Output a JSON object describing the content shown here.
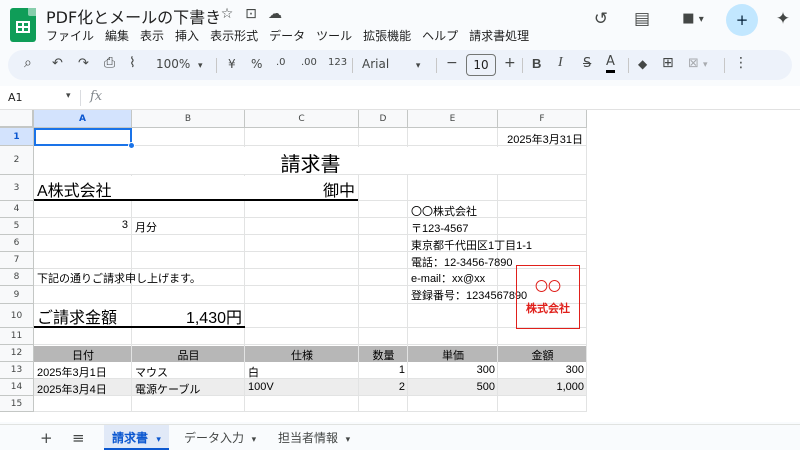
{
  "app": {
    "title": "PDF化とメールの下書き",
    "menu": [
      "ファイル",
      "編集",
      "表示",
      "挿入",
      "表示形式",
      "データ",
      "ツール",
      "拡張機能",
      "ヘルプ",
      "請求書処理"
    ]
  },
  "icons": {
    "star": "☆",
    "folder": "⊡",
    "cloud": "☁",
    "history": "↺",
    "comment": "▤",
    "video": "■",
    "share": "+",
    "gemini": "✦"
  },
  "toolbar": {
    "search": "⌕",
    "undo": "↶",
    "redo": "↷",
    "print": "⎙",
    "paint_format": "⌇",
    "zoom": "100%",
    "currency": "¥",
    "percent": "%",
    "decimal_decrease": ".0",
    "decimal_increase": ".00",
    "number_format": "123",
    "font": "Arial",
    "minus": "−",
    "font_size": "10",
    "plus": "+",
    "bold": "B",
    "italic": "I",
    "strike": "S",
    "text_color": "A",
    "fill": "◆",
    "borders": "⊞",
    "merge": "⊠",
    "more": "⋮",
    "caret": "▾"
  },
  "formula_bar": {
    "name_box": "A1",
    "fx": "fx"
  },
  "columns": [
    "A",
    "B",
    "C",
    "D",
    "E",
    "F"
  ],
  "rows": [
    "1",
    "2",
    "3",
    "4",
    "5",
    "6",
    "7",
    "8",
    "9",
    "10",
    "11",
    "12",
    "13",
    "14",
    "15"
  ],
  "sheet": {
    "date": "2025年3月31日",
    "title": "請求書",
    "customer": "A株式会社",
    "honorific": "御中",
    "month_num": "3",
    "month_label": "月分",
    "intro": "下記の通りご請求申し上げます。",
    "total_label": "ご請求金額",
    "total_value": "1,430円",
    "issuer": {
      "company": "〇〇株式会社",
      "postal": "〒123-4567",
      "address": "東京都千代田区1丁目1-1",
      "phone": "電話：12-3456-7890",
      "email": "e-mail：xx@xx",
      "reg_no": "登録番号：1234567890"
    },
    "seal": {
      "top": "〇〇",
      "bottom": "株式会社"
    },
    "table": {
      "headers": [
        "日付",
        "品目",
        "仕様",
        "数量",
        "単価",
        "金額"
      ],
      "rows": [
        [
          "2025年3月1日",
          "マウス",
          "白",
          "1",
          "300",
          "300"
        ],
        [
          "2025年3月4日",
          "電源ケーブル",
          "100V",
          "2",
          "500",
          "1,000"
        ]
      ]
    }
  },
  "sheets": {
    "add": "+",
    "all": "≡",
    "tabs": [
      "請求書",
      "データ入力",
      "担当者情報"
    ],
    "caret": "▾"
  },
  "colors": {
    "sheets_green": "#0f9d58",
    "selection_blue": "#1a73e8",
    "seal_red": "#e0201b",
    "table_header_gray": "#b7b7b7"
  }
}
